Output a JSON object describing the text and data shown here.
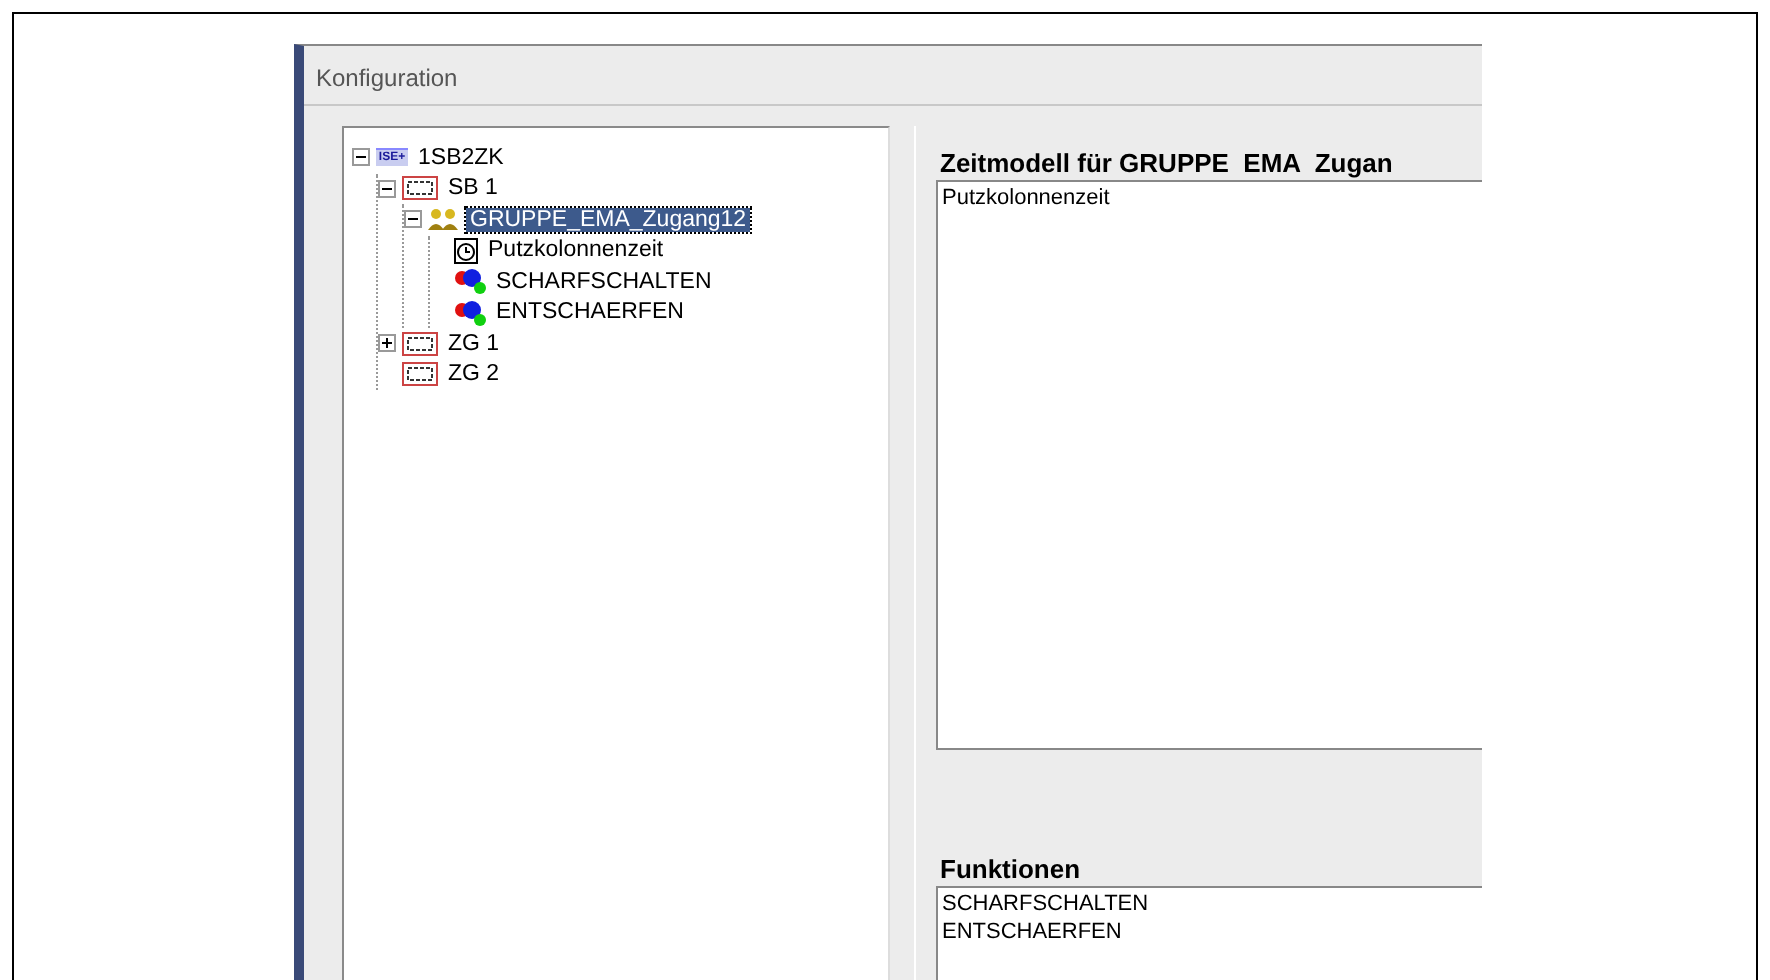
{
  "window": {
    "title": "Konfiguration"
  },
  "tree": [
    {
      "label": "1SB2ZK",
      "kind": "device",
      "icon_text": "ISE+",
      "expanded": true,
      "selected": false,
      "children": [
        {
          "label": "SB 1",
          "kind": "zone",
          "expanded": true,
          "selected": false,
          "children": [
            {
              "label": "GRUPPE_EMA_Zugang12",
              "kind": "group",
              "expanded": true,
              "selected": true,
              "children": [
                {
                  "label": "Putzkolonnenzeit",
                  "kind": "time",
                  "selected": false
                },
                {
                  "label": "SCHARFSCHALTEN",
                  "kind": "function",
                  "selected": false
                },
                {
                  "label": "ENTSCHAERFEN",
                  "kind": "function",
                  "selected": false
                }
              ]
            }
          ]
        },
        {
          "label": "ZG 1",
          "kind": "zone",
          "expanded": false,
          "selected": false
        },
        {
          "label": "ZG 2",
          "kind": "zone",
          "selected": false
        }
      ]
    }
  ],
  "time_model": {
    "heading": "Zeitmodell für GRUPPE  EMA  Zugan",
    "items": [
      "Putzkolonnenzeit"
    ]
  },
  "functions": {
    "heading": "Funktionen",
    "items": [
      "SCHARFSCHALTEN",
      "ENTSCHAERFEN"
    ]
  }
}
